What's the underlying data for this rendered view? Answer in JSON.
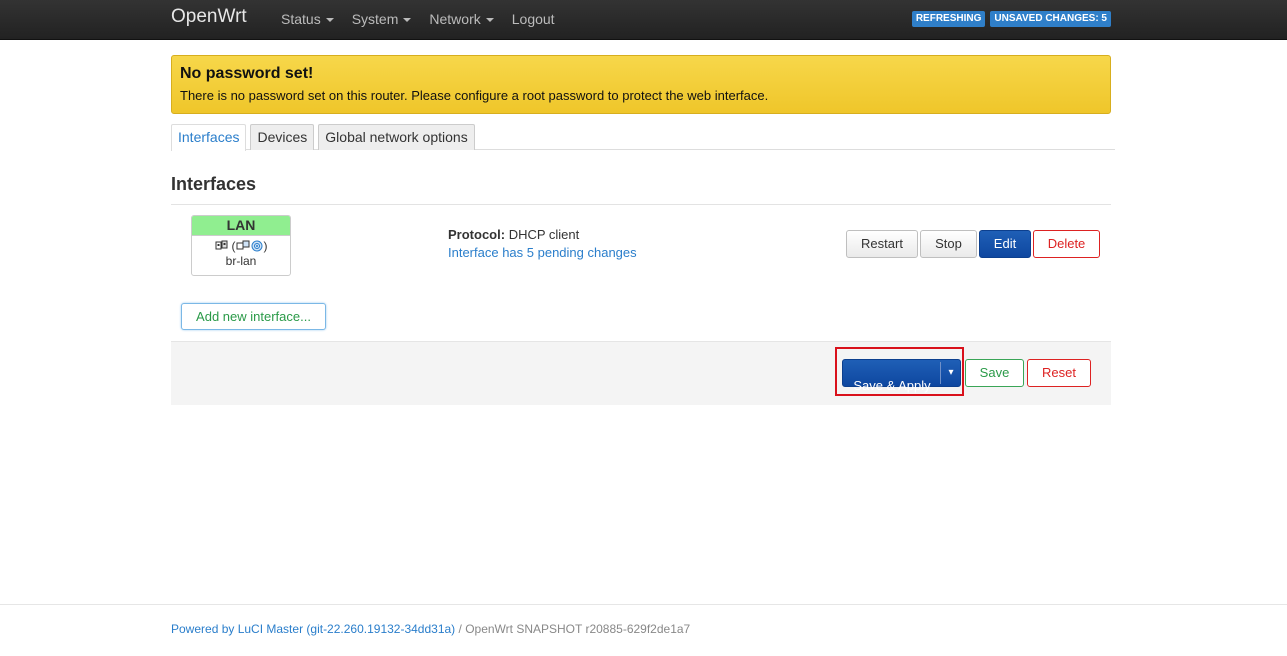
{
  "header": {
    "brand": "OpenWrt",
    "menu": [
      {
        "label": "Status",
        "has_dropdown": true
      },
      {
        "label": "System",
        "has_dropdown": true
      },
      {
        "label": "Network",
        "has_dropdown": true
      },
      {
        "label": "Logout",
        "has_dropdown": false
      }
    ],
    "badges": {
      "refreshing": "REFRESHING",
      "unsaved": "UNSAVED CHANGES: 5"
    }
  },
  "alert": {
    "title": "No password set!",
    "text": "There is no password set on this router. Please configure a root password to protect the web interface."
  },
  "tabs": [
    {
      "label": "Interfaces",
      "active": true
    },
    {
      "label": "Devices",
      "active": false
    },
    {
      "label": "Global network options",
      "active": false
    }
  ],
  "section": {
    "title": "Interfaces"
  },
  "interface": {
    "name": "LAN",
    "name_bg": "#90ee90",
    "device": "br-lan",
    "protocol_label": "Protocol:",
    "protocol_value": "DHCP client",
    "pending": "Interface has 5 pending changes",
    "actions": {
      "restart": "Restart",
      "stop": "Stop",
      "edit": "Edit",
      "delete": "Delete"
    }
  },
  "add_interface": "Add new interface...",
  "form_actions": {
    "save_apply": "Save & Apply",
    "dropdown_arrow": "▾",
    "save": "Save",
    "reset": "Reset"
  },
  "footer": {
    "powered": "Powered by LuCI Master (git-22.260.19132-34dd31a)",
    "separator": " / ",
    "version": "OpenWrt SNAPSHOT r20885-629f2de1a7"
  },
  "colors": {
    "primary": "#0e47a0",
    "danger": "#dd2222",
    "success": "#2a9a48",
    "link": "#2a7ecb",
    "highlight": "#d9111b"
  }
}
